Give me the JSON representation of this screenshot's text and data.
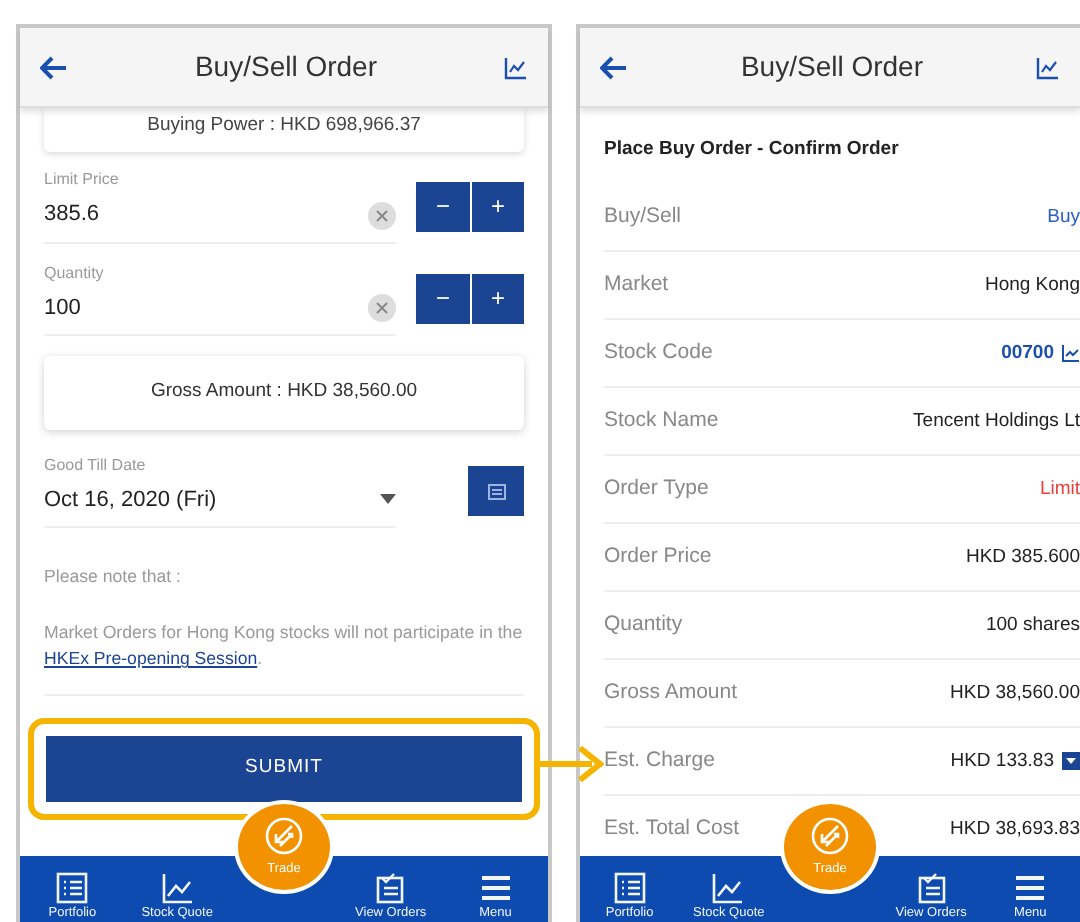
{
  "order_form": {
    "title": "Buy/Sell Order",
    "buying_power": "Buying Power : HKD 698,966.37",
    "inputs": [
      {
        "label": "Limit Price",
        "value": "385.6",
        "minus": "−",
        "plus": "+"
      },
      {
        "label": "Quantity",
        "value": "100",
        "minus": "−",
        "plus": "+"
      }
    ],
    "gross_amount": "Gross Amount : HKD 38,560.00",
    "good_till": {
      "label": "Good Till Date",
      "value": "Oct 16, 2020 (Fri)"
    },
    "note_heading": "Please note that :",
    "note": {
      "before": "Market Orders for Hong Kong stocks will not participate in the ",
      "link": "HKEx Pre-opening Session",
      "after": "."
    },
    "submit": "SUBMIT",
    "highlighted": true,
    "nav": [
      {
        "label": "Portfolio",
        "selected": false
      },
      {
        "label": "Stock Quote",
        "selected": false
      },
      {
        "label": "Trade",
        "selected": true
      },
      {
        "label": "View Orders",
        "selected": false
      },
      {
        "label": "Menu",
        "selected": false
      }
    ]
  },
  "confirm": {
    "title": "Buy/Sell Order",
    "heading": "Place Buy Order - Confirm Order",
    "rows": [
      {
        "label": "Buy/Sell",
        "value": "Buy",
        "kind": "accent"
      },
      {
        "label": "Market",
        "value": "Hong Kong",
        "kind": "plain"
      },
      {
        "label": "Stock Code",
        "value": "00700",
        "kind": "code"
      },
      {
        "label": "Stock Name",
        "value": "Tencent Holdings Lt",
        "kind": "plain"
      },
      {
        "label": "Order Type",
        "value": "Limit",
        "kind": "alert"
      },
      {
        "label": "Order Price",
        "value": "HKD 385.600",
        "kind": "plain"
      },
      {
        "label": "Quantity",
        "value": "100 shares",
        "kind": "plain"
      },
      {
        "label": "Gross Amount",
        "value": "HKD 38,560.00",
        "kind": "plain"
      },
      {
        "label": "Est. Charge",
        "value": "HKD 133.83",
        "kind": "dropdown"
      },
      {
        "label": "Est. Total Cost",
        "value": "HKD 38,693.83",
        "kind": "plain"
      }
    ],
    "nav": [
      {
        "label": "Portfolio",
        "selected": false
      },
      {
        "label": "Stock Quote",
        "selected": false
      },
      {
        "label": "Trade",
        "selected": true
      },
      {
        "label": "View Orders",
        "selected": false
      },
      {
        "label": "Menu",
        "selected": false
      }
    ]
  }
}
